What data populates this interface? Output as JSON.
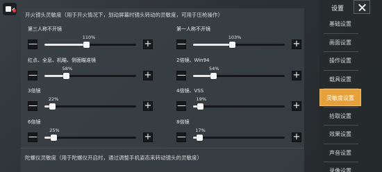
{
  "section": {
    "fire_title": "开火镜头灵敏度（用于开火情况下，划动屏幕时镜头转动的灵敏度，可用于压枪操作）",
    "gyro_title": "陀螺仪灵敏度（用于陀螺仪开启时，通过调整手机姿态来转动镜头的灵敏度）"
  },
  "sliders": [
    {
      "label": "第三人称不开镜",
      "percent_text": "110%",
      "value": 0.46
    },
    {
      "label": "第一人称不开镜",
      "percent_text": "103%",
      "value": 0.43
    },
    {
      "label": "红点、全息、机瞄、侧面瞄准镜",
      "percent_text": "58%",
      "value": 0.24
    },
    {
      "label": "2倍镜、Win94",
      "percent_text": "54%",
      "value": 0.22
    },
    {
      "label": "3倍镜",
      "percent_text": "22%",
      "value": 0.09
    },
    {
      "label": "4倍镜、VSS",
      "percent_text": "19%",
      "value": 0.08
    },
    {
      "label": "6倍镜",
      "percent_text": "25%",
      "value": 0.1
    },
    {
      "label": "8倍镜",
      "percent_text": "17%",
      "value": 0.07
    }
  ],
  "buttons": {
    "minus": "—",
    "plus": "+"
  },
  "sidebar": {
    "title": "设置",
    "items": [
      {
        "label": "基础设置",
        "active": false
      },
      {
        "label": "画面设置",
        "active": false
      },
      {
        "label": "操作设置",
        "active": false
      },
      {
        "label": "载具设置",
        "active": false
      },
      {
        "label": "灵敏度设置",
        "active": true
      },
      {
        "label": "拾取设置",
        "active": false
      },
      {
        "label": "效果设置",
        "active": false
      },
      {
        "label": "声音设置",
        "active": false
      },
      {
        "label": "录像设置",
        "active": false
      }
    ]
  },
  "colors": {
    "accent": "#e6a13a",
    "panel": "#3c4246",
    "track": "#15171a"
  }
}
